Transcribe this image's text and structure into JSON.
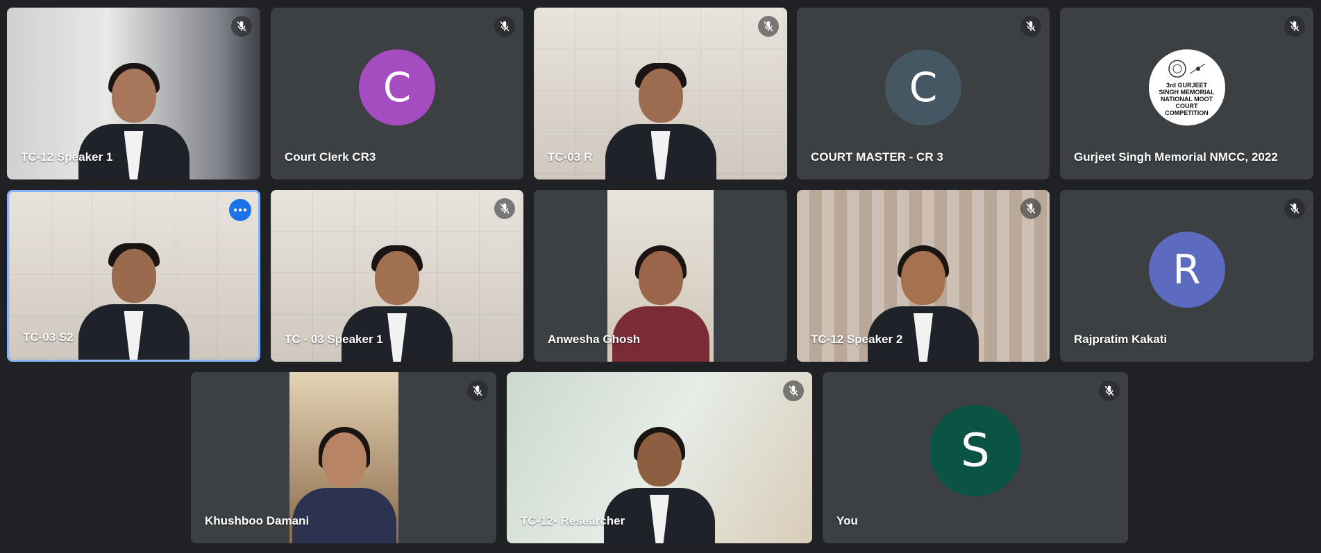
{
  "participants": [
    {
      "name": "TC-12 Speaker 1"
    },
    {
      "name": "Court Clerk CR3",
      "initial": "C",
      "color": "#a64cc1"
    },
    {
      "name": "TC-03 R"
    },
    {
      "name": "COURT MASTER - CR 3",
      "initial": "C",
      "color": "#445763"
    },
    {
      "name": "Gurjeet Singh Memorial NMCC, 2022",
      "logo_text": "3rd GURJEET SINGH MEMORIAL NATIONAL MOOT COURT COMPETITION"
    },
    {
      "name": "TC-03 S2"
    },
    {
      "name": "TC - 03 Speaker 1"
    },
    {
      "name": "Anwesha Ghosh"
    },
    {
      "name": "TC-12 Speaker 2"
    },
    {
      "name": "Rajpratim Kakati",
      "initial": "R",
      "color": "#5c6bc0"
    },
    {
      "name": "Khushboo Damani"
    },
    {
      "name": "TC-12- Researcher"
    },
    {
      "name": "You",
      "initial": "S",
      "color": "#0b5345"
    }
  ],
  "icons": {
    "mic_off": "mic-off-icon",
    "more": "more-options-icon"
  },
  "colors": {
    "background": "#202124",
    "tile": "#3c4043",
    "active_border": "#8ab4f8",
    "more_button": "#1a73e8"
  }
}
